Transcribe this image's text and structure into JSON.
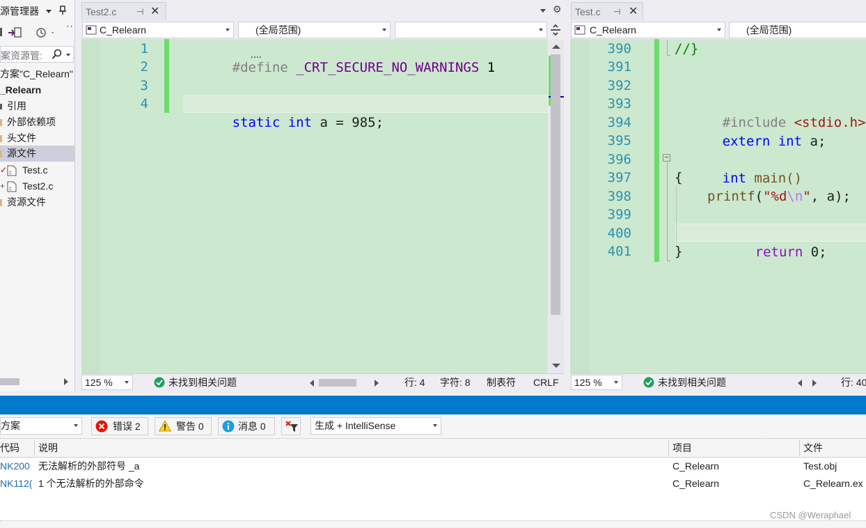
{
  "solution_explorer": {
    "title": "源管理器",
    "search_placeholder": "案资源管:",
    "solution_label": "方案\"C_Relearn\"",
    "project_name": "_Relearn",
    "items": [
      {
        "label": "引用"
      },
      {
        "label": "外部依赖项"
      },
      {
        "label": "头文件"
      },
      {
        "label": "源文件"
      },
      {
        "label": "Test.c"
      },
      {
        "label": "Test2.c"
      },
      {
        "label": "资源文件"
      }
    ]
  },
  "left_editor": {
    "tab_title": "Test2.c",
    "project_dropdown": "C_Relearn",
    "scope_dropdown": "(全局范围)",
    "member_dropdown": "",
    "line_numbers": [
      "1",
      "2",
      "3",
      "4"
    ],
    "lines": {
      "l1_define": "#define",
      "l1_macro": "_CRT_SECURE_NO_WARNINGS",
      "l1_value": "1",
      "l4_static": "static",
      "l4_int": "int",
      "l4_rest": "a = 985;"
    },
    "status": {
      "zoom": "125 %",
      "issues": "未找到相关问题",
      "row": "行: 4",
      "char": "字符: 8",
      "tabs": "制表符",
      "eol": "CRLF"
    }
  },
  "right_editor": {
    "tab_title": "Test.c",
    "project_dropdown": "C_Relearn",
    "scope_dropdown": "(全局范围)",
    "line_numbers": [
      "390",
      "391",
      "392",
      "393",
      "394",
      "395",
      "396",
      "397",
      "398",
      "399",
      "400",
      "401"
    ],
    "lines": {
      "l390": "//}",
      "l393_inc": "#include",
      "l393_hdr": "<stdio.h>",
      "l394_extern": "extern",
      "l394_int": "int",
      "l394_rest": "a;",
      "l396_int": "int",
      "l396_rest": "main()",
      "l397": "{",
      "l398_fn": "printf",
      "l398_open": "(",
      "l398_str": "\"%d",
      "l398_esc": "\\n",
      "l398_strend": "\"",
      "l398_rest": ", a);",
      "l400_return": "return",
      "l400_rest": "0;",
      "l401": "}"
    },
    "status": {
      "zoom": "125 %",
      "issues": "未找到相关问题",
      "row": "行: 40"
    }
  },
  "error_list": {
    "scope_dropdown": "方案",
    "errors_btn": "错误 2",
    "warnings_btn": "警告 0",
    "messages_btn": "消息 0",
    "build_dropdown": "生成 + IntelliSense",
    "columns": {
      "code": "代码",
      "desc": "说明",
      "project": "项目",
      "file": "文件"
    },
    "rows": [
      {
        "code": "NK200",
        "desc": "无法解析的外部符号 _a",
        "project": "C_Relearn",
        "file": "Test.obj"
      },
      {
        "code": "NK112(",
        "desc": "1 个无法解析的外部命令",
        "project": "C_Relearn",
        "file": "C_Relearn.ex"
      }
    ]
  },
  "watermark": "CSDN @Weraphael",
  "colors": {
    "editor_bg": "#cce8cf",
    "change_bar": "#6ddb6d",
    "accent_strip": "#007acc",
    "keyword": "#0000ff",
    "line_number": "#2b91af"
  }
}
